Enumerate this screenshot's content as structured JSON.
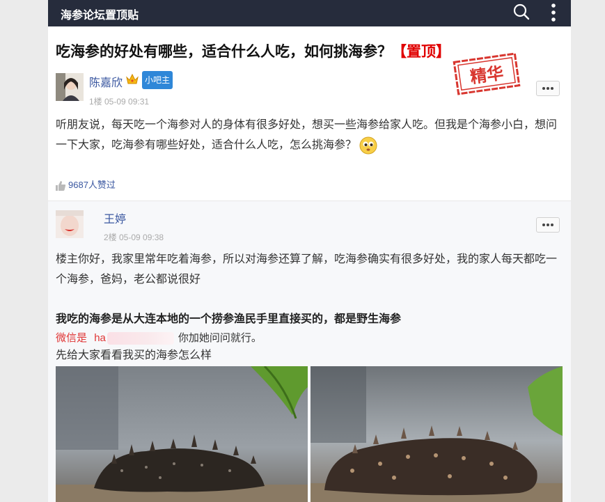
{
  "header": {
    "title": "海参论坛置顶贴",
    "icons": [
      "search-icon",
      "more-vertical-icon"
    ]
  },
  "post": {
    "title": "吃海参的好处有哪些，适合什么人吃，如何挑海参？",
    "pin_tag": "【置顶】",
    "stamp": "精华"
  },
  "floor1": {
    "author": "陈嘉欣",
    "badge": "小吧主",
    "meta": "1楼 05-09 09:31",
    "body": "听朋友说，每天吃一个海参对人的身体有很多好处，想买一些海参给家人吃。但我是个海参小白，想问一下大家，吃海参有哪些好处，适合什么人吃，怎么挑海参？",
    "likes": "9687人赞过"
  },
  "floor2": {
    "author": "王婷",
    "meta": "2楼 05-09 09:38",
    "body": "楼主你好，我家里常年吃着海参，所以对海参还算了解，吃海参确实有很多好处，我的家人每天都吃一个海参，爸妈，老公都说很好",
    "bold": "我吃的海参是从大连本地的一个捞参渔民手里直接买的，都是野生海参",
    "wechat_label": "微信是",
    "wechat_partial": "ha",
    "wechat_tail": "你加她问问就行。",
    "photos_intro": "先给大家看看我买的海参怎么样"
  },
  "colors": {
    "topbar": "#262c3c",
    "pin": "#e00000",
    "author": "#3a57a0",
    "badge": "#2f87d8",
    "stamp": "#d8362f"
  }
}
